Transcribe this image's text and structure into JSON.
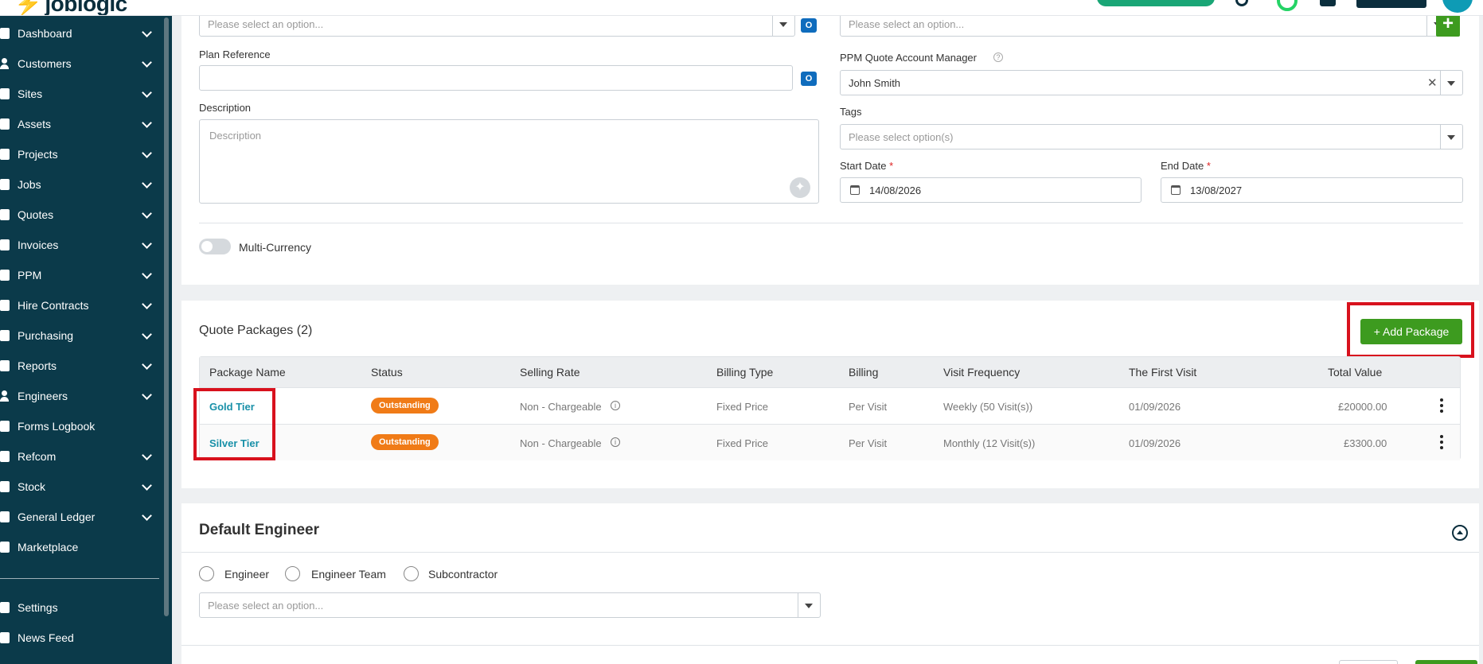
{
  "header": {
    "logo_text": "joblogic"
  },
  "sidebar": {
    "items": [
      {
        "label": "Dashboard"
      },
      {
        "label": "Customers"
      },
      {
        "label": "Sites"
      },
      {
        "label": "Assets"
      },
      {
        "label": "Projects"
      },
      {
        "label": "Jobs"
      },
      {
        "label": "Quotes"
      },
      {
        "label": "Invoices"
      },
      {
        "label": "PPM"
      },
      {
        "label": "Hire Contracts"
      },
      {
        "label": "Purchasing"
      },
      {
        "label": "Reports"
      },
      {
        "label": "Engineers"
      },
      {
        "label": "Forms Logbook"
      },
      {
        "label": "Refcom"
      },
      {
        "label": "Stock"
      },
      {
        "label": "General Ledger"
      },
      {
        "label": "Marketplace"
      }
    ],
    "bottom_items": [
      {
        "label": "Settings"
      },
      {
        "label": "News Feed"
      }
    ]
  },
  "form": {
    "top_left_select_placeholder": "Please select an option...",
    "top_right_select_placeholder": "Please select an option...",
    "plan_reference_label": "Plan Reference",
    "plan_reference_value": "",
    "description_label": "Description",
    "description_placeholder": "Description",
    "account_manager_label": "PPM Quote Account Manager",
    "account_manager_value": "John Smith",
    "tags_label": "Tags",
    "tags_placeholder": "Please select option(s)",
    "start_date_label": "Start Date",
    "start_date_value": "14/08/2026",
    "end_date_label": "End Date",
    "end_date_value": "13/08/2027",
    "required_mark": "*",
    "multi_currency_label": "Multi-Currency",
    "multi_currency_enabled": false
  },
  "packages": {
    "title": "Quote Packages (2)",
    "add_button": "+ Add Package",
    "columns": [
      "Package Name",
      "Status",
      "Selling Rate",
      "Billing Type",
      "Billing",
      "Visit Frequency",
      "The First Visit",
      "Total Value"
    ],
    "rows": [
      {
        "name": "Gold Tier",
        "status": "Outstanding",
        "selling_rate": "Non - Chargeable",
        "billing_type": "Fixed Price",
        "billing": "Per Visit",
        "visit_frequency": "Weekly (50 Visit(s))",
        "first_visit": "01/09/2026",
        "total_value": "£20000.00"
      },
      {
        "name": "Silver Tier",
        "status": "Outstanding",
        "selling_rate": "Non - Chargeable",
        "billing_type": "Fixed Price",
        "billing": "Per Visit",
        "visit_frequency": "Monthly (12 Visit(s))",
        "first_visit": "01/09/2026",
        "total_value": "£3300.00"
      }
    ]
  },
  "default_engineer": {
    "title": "Default Engineer",
    "options": [
      "Engineer",
      "Engineer Team",
      "Subcontractor"
    ],
    "select_placeholder": "Please select an option..."
  },
  "colors": {
    "sidebar_bg": "#0b3a4a",
    "primary_green": "#3d9b1f",
    "status_orange": "#f07b17",
    "link_teal": "#1890a8",
    "highlight_red": "#d8111d"
  }
}
